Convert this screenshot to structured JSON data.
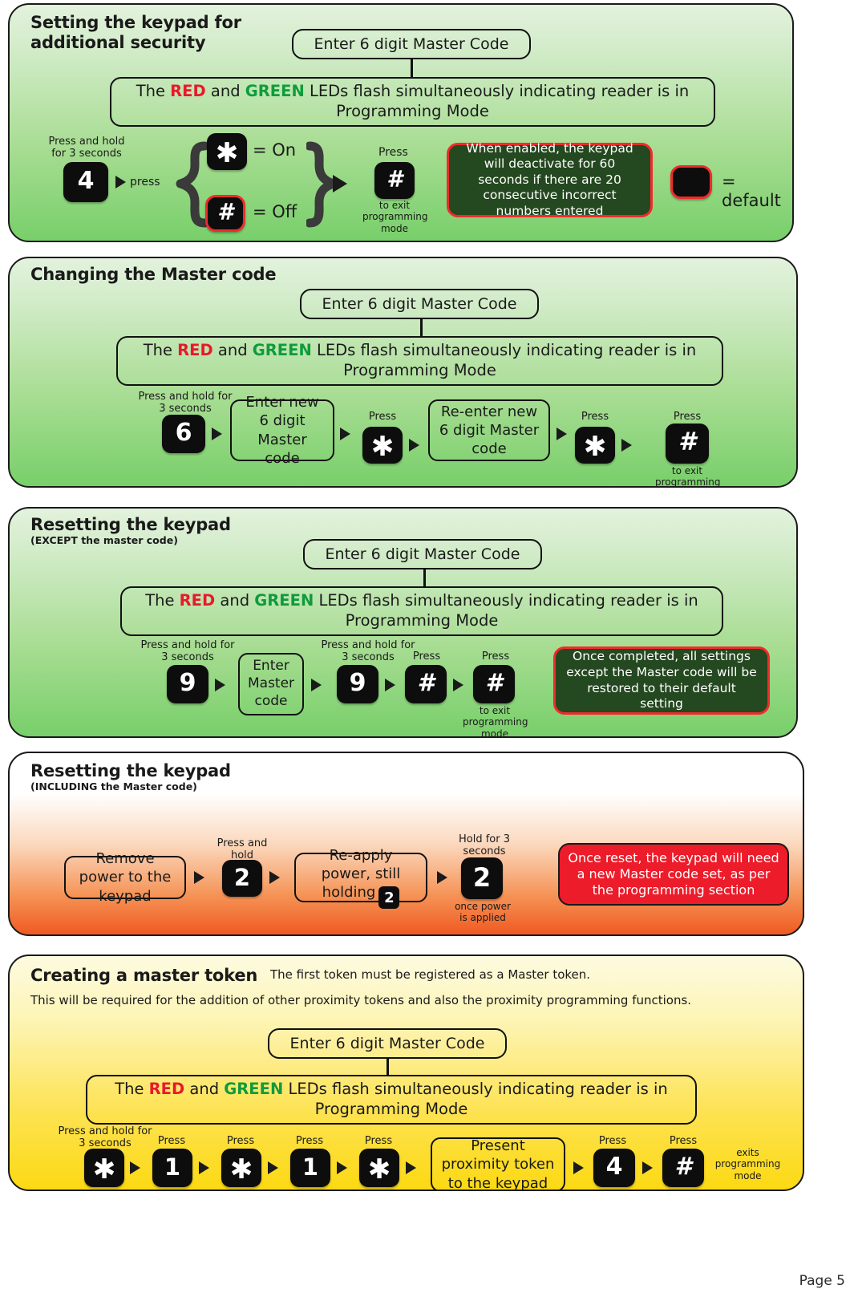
{
  "page": {
    "footer": "Page 5"
  },
  "common": {
    "enter_master_code": "Enter 6 digit Master Code",
    "led_prefix": "The ",
    "led_red": "RED",
    "led_and": " and ",
    "led_green": "GREEN",
    "led_suffix": " LEDs flash simultaneously indicating reader is in Programming Mode",
    "press": "Press",
    "press_and_hold_3s": "Press and hold for 3 seconds",
    "to_exit_programming_mode": "to exit programming mode"
  },
  "colors": {
    "red": "#e8192c",
    "green": "#0f9b3c",
    "key_black": "#0d0d0d",
    "red_ring": "#ef2b2b",
    "note_dark_green": "#24481f",
    "note_red": "#ed1c2a"
  },
  "section1": {
    "title": "Setting the keypad for additional security",
    "master_code_box": "Enter 6 digit Master Code",
    "keys": {
      "four": "4",
      "star": "✱",
      "hash": "#",
      "exit_hash": "#"
    },
    "labels": {
      "press_hold": "Press and hold for 3 seconds",
      "press_small": "press",
      "on": "= On",
      "off": "= Off",
      "press": "Press",
      "to_exit": "to exit programming mode",
      "default": "= default"
    },
    "note": "When enabled, the keypad will deactivate for 60 seconds if there are 20 consecutive incorrect numbers entered"
  },
  "section2": {
    "title": "Changing the Master code",
    "master_code_box": "Enter 6 digit Master Code",
    "steps": [
      {
        "type": "key",
        "label": "6",
        "caption": "Press and hold for 3 seconds"
      },
      {
        "type": "box",
        "label": "Enter new 6 digit Master code",
        "caption": ""
      },
      {
        "type": "key",
        "label": "✱",
        "caption": "Press"
      },
      {
        "type": "box",
        "label": "Re-enter new 6 digit Master code",
        "caption": ""
      },
      {
        "type": "key",
        "label": "✱",
        "caption": "Press"
      },
      {
        "type": "key",
        "label": "#",
        "caption": "Press",
        "sub": "to exit programming mode"
      }
    ]
  },
  "section3": {
    "title": "Resetting the keypad",
    "subtitle": "(EXCEPT the master code)",
    "master_code_box": "Enter 6 digit Master Code",
    "steps": [
      {
        "type": "key",
        "label": "9",
        "caption": "Press and hold for 3 seconds"
      },
      {
        "type": "box",
        "label": "Enter Master code",
        "caption": ""
      },
      {
        "type": "key",
        "label": "9",
        "caption": "Press and hold for 3 seconds"
      },
      {
        "type": "key",
        "label": "#",
        "caption": "Press"
      },
      {
        "type": "key",
        "label": "#",
        "caption": "Press",
        "sub": "to exit programming mode"
      }
    ],
    "note": "Once completed, all settings except the Master code will be restored to their default setting"
  },
  "section4": {
    "title": "Resetting the keypad",
    "subtitle": "(INCLUDING the Master code)",
    "steps": [
      {
        "type": "box",
        "label": "Remove power to the keypad",
        "caption": ""
      },
      {
        "type": "key",
        "label": "2",
        "caption": "Press and hold"
      },
      {
        "type": "box",
        "label": "Re-apply power, still holding",
        "inline_key": "2",
        "caption": ""
      },
      {
        "type": "key",
        "label": "2",
        "caption": "Hold for 3 seconds",
        "sub": "once power is applied"
      }
    ],
    "note": "Once reset, the keypad will need a new Master code set, as per the programming section"
  },
  "section5": {
    "title": "Creating a master token",
    "lead": "The first token must be registered as a Master token.",
    "description": "This will be required for the addition of other proximity tokens and also the proximity programming functions.",
    "master_code_box": "Enter 6 digit Master Code",
    "steps": [
      {
        "type": "key",
        "label": "✱",
        "caption": "Press and hold for 3 seconds"
      },
      {
        "type": "key",
        "label": "1",
        "caption": "Press"
      },
      {
        "type": "key",
        "label": "✱",
        "caption": "Press"
      },
      {
        "type": "key",
        "label": "1",
        "caption": "Press"
      },
      {
        "type": "key",
        "label": "✱",
        "caption": "Press"
      },
      {
        "type": "box",
        "label": "Present proximity token to the keypad",
        "caption": ""
      },
      {
        "type": "key",
        "label": "4",
        "caption": "Press"
      },
      {
        "type": "key",
        "label": "#",
        "caption": "Press",
        "sub": "exits programming mode"
      }
    ]
  }
}
